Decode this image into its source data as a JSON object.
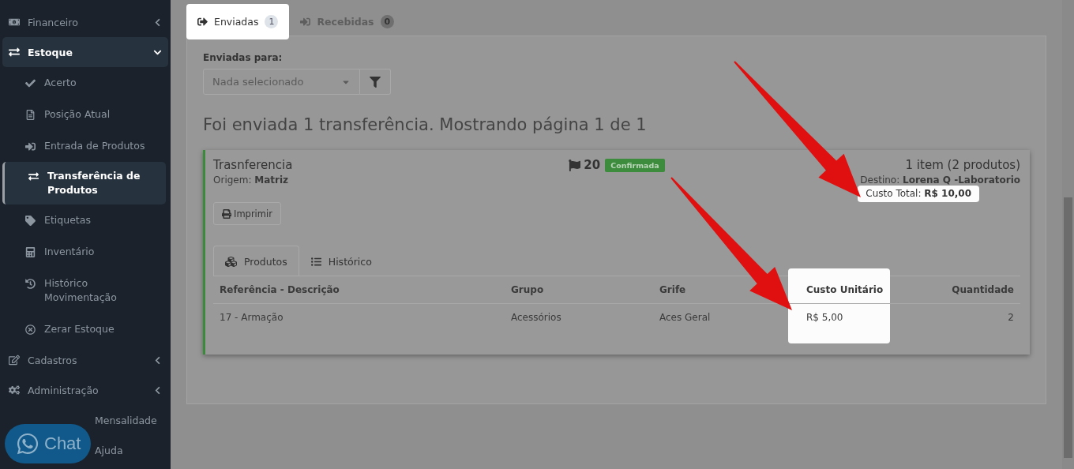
{
  "sidebar": {
    "items": [
      {
        "kind": "group",
        "label": "Financeiro",
        "expanded": false,
        "selected": false
      },
      {
        "kind": "group",
        "label": "Estoque",
        "expanded": true,
        "selected": true,
        "children": [
          {
            "label": "Acerto",
            "selected": false
          },
          {
            "label": "Posição Atual",
            "selected": false
          },
          {
            "label": "Entrada de Produtos",
            "selected": false
          },
          {
            "label": "Transferência de Produtos",
            "selected": true
          },
          {
            "label": "Etiquetas",
            "selected": false
          },
          {
            "label": "Inventário",
            "selected": false
          },
          {
            "label": "Histórico Movimentação",
            "selected": false
          },
          {
            "label": "Zerar Estoque",
            "selected": false
          }
        ]
      },
      {
        "kind": "group",
        "label": "Cadastros",
        "expanded": false,
        "selected": false
      },
      {
        "kind": "group",
        "label": "Administração",
        "expanded": false,
        "selected": false
      },
      {
        "kind": "link",
        "label": "Mensalidade",
        "selected": false
      },
      {
        "kind": "link",
        "label": "Ajuda",
        "selected": false
      }
    ]
  },
  "chat": {
    "label": "Chat"
  },
  "tabs": [
    {
      "label": "Enviadas",
      "count": "1",
      "selected": true
    },
    {
      "label": "Recebidas",
      "count": "0",
      "selected": false
    }
  ],
  "filter": {
    "label": "Enviadas para:",
    "placeholder": "Nada selecionado"
  },
  "summary": "Foi enviada 1 transferência. Mostrando página 1 de 1",
  "transfer": {
    "title": "Trasnferencia",
    "origin": "Origem: **Matriz**",
    "number": "20",
    "status": "Confirmada",
    "items": "1 item (2 produtos)",
    "destination": "Destino: **Lorena Q -Laboratorio**",
    "total_cost": {
      "text": "Custo Total: **R$ 10,00**",
      "highlighted": true
    },
    "print": "Imprimir",
    "tabs": [
      {
        "label": "Produtos",
        "selected": true
      },
      {
        "label": "Histórico",
        "selected": false
      }
    ],
    "table": {
      "columns": [
        {
          "label": "Referência - Descrição",
          "highlighted": false
        },
        {
          "label": "Grupo",
          "highlighted": false
        },
        {
          "label": "Grife",
          "highlighted": false
        },
        {
          "label": "Custo Unitário",
          "highlighted": true
        },
        {
          "label": "Quantidade",
          "highlighted": false
        }
      ],
      "rows": [
        [
          "17 - Armação",
          "Acessórios",
          "Aces Geral",
          "R$ 5,00",
          "2"
        ]
      ]
    }
  }
}
